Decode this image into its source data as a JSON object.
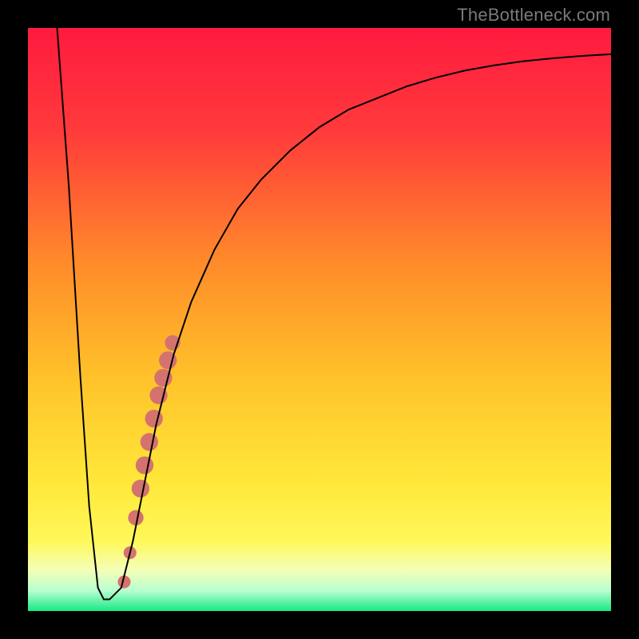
{
  "watermark": "TheBottleneck.com",
  "chart_data": {
    "type": "line",
    "title": "",
    "xlabel": "",
    "ylabel": "",
    "xlim": [
      0,
      100
    ],
    "ylim": [
      0,
      100
    ],
    "background_gradient": {
      "stops": [
        {
          "pos": 0.0,
          "color": "#ff1a3f"
        },
        {
          "pos": 0.18,
          "color": "#ff3b3b"
        },
        {
          "pos": 0.4,
          "color": "#ff8a2a"
        },
        {
          "pos": 0.6,
          "color": "#ffc22a"
        },
        {
          "pos": 0.78,
          "color": "#ffe83a"
        },
        {
          "pos": 0.88,
          "color": "#fff85a"
        },
        {
          "pos": 0.93,
          "color": "#f4ffb8"
        },
        {
          "pos": 0.965,
          "color": "#b8ffd0"
        },
        {
          "pos": 1.0,
          "color": "#17e884"
        }
      ]
    },
    "series": [
      {
        "name": "curve",
        "color": "#000000",
        "x": [
          5,
          7,
          9,
          10.5,
          12,
          13,
          14,
          16,
          18,
          20,
          22,
          25,
          28,
          32,
          36,
          40,
          45,
          50,
          55,
          60,
          65,
          70,
          75,
          80,
          85,
          90,
          95,
          100
        ],
        "y": [
          100,
          73,
          40,
          18,
          4,
          2,
          2,
          4,
          12,
          22,
          32,
          44,
          53,
          62,
          69,
          74,
          79,
          83,
          86,
          88,
          90,
          91.5,
          92.7,
          93.6,
          94.3,
          94.8,
          95.2,
          95.5
        ]
      }
    ],
    "markers": {
      "name": "highlight",
      "color": "#d4736e",
      "points": [
        {
          "x": 16.5,
          "y": 5,
          "r": 5
        },
        {
          "x": 17.5,
          "y": 10,
          "r": 5
        },
        {
          "x": 18.5,
          "y": 16,
          "r": 6
        },
        {
          "x": 19.3,
          "y": 21,
          "r": 7
        },
        {
          "x": 20.0,
          "y": 25,
          "r": 7
        },
        {
          "x": 20.8,
          "y": 29,
          "r": 7
        },
        {
          "x": 21.6,
          "y": 33,
          "r": 7
        },
        {
          "x": 22.4,
          "y": 37,
          "r": 7
        },
        {
          "x": 23.2,
          "y": 40,
          "r": 7
        },
        {
          "x": 24.0,
          "y": 43,
          "r": 7
        },
        {
          "x": 24.8,
          "y": 46,
          "r": 6
        }
      ]
    }
  }
}
